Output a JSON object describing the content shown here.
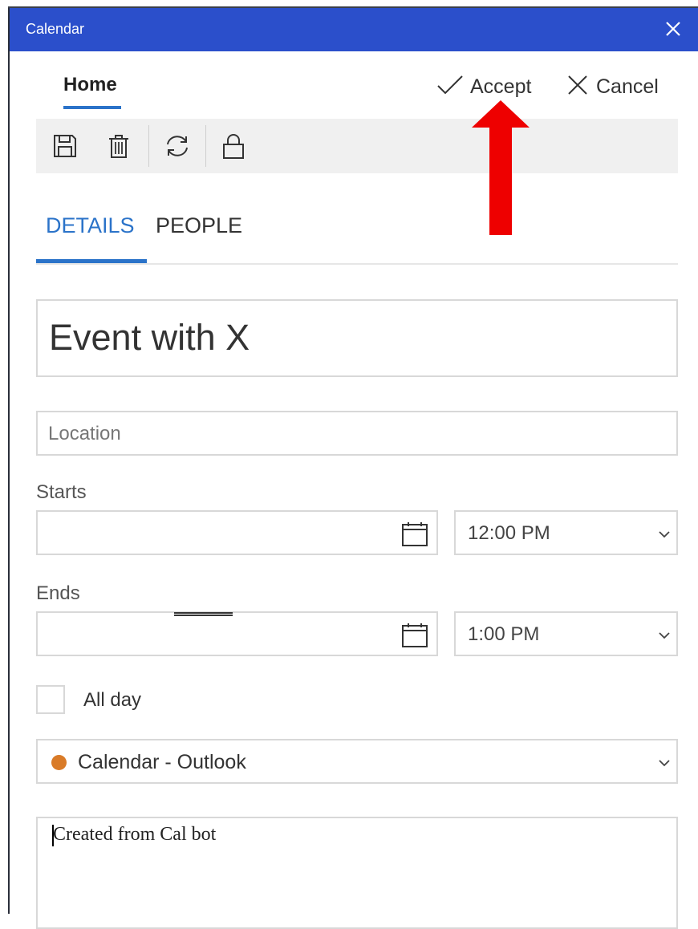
{
  "window": {
    "title": "Calendar"
  },
  "header": {
    "home_tab": "Home",
    "accept_label": "Accept",
    "cancel_label": "Cancel"
  },
  "toolbar": {
    "icons": [
      "save-icon",
      "delete-icon",
      "repeat-icon",
      "lock-icon"
    ]
  },
  "tabs": {
    "details": "DETAILS",
    "people": "PEOPLE",
    "active": "DETAILS"
  },
  "form": {
    "event_title": "Event with X",
    "location_placeholder": "Location",
    "starts_label": "Starts",
    "start_date": "",
    "start_time": "12:00 PM",
    "ends_label": "Ends",
    "end_date": "",
    "end_time": "1:00 PM",
    "all_day_label": "All day",
    "all_day_checked": false,
    "calendar": "Calendar - Outlook",
    "calendar_color": "#d97b28",
    "notes": "Created from Cal bot"
  },
  "colors": {
    "titlebar": "#2b4fcb",
    "accent": "#2b73c9",
    "annotation_arrow": "#ee0000"
  }
}
